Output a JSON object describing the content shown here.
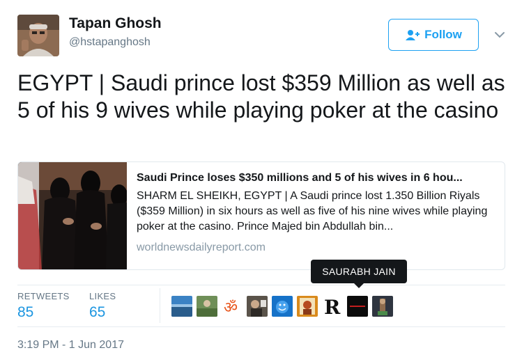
{
  "user": {
    "name": "Tapan Ghosh",
    "handle": "@hstapanghosh"
  },
  "follow_button": {
    "label": "Follow"
  },
  "tweet": {
    "text": "EGYPT | Saudi prince lost $359 Million as well as 5 of his 9 wives while playing poker at the casino"
  },
  "card": {
    "title": "Saudi Prince loses $350 millions and 5 of his wives in 6 hou...",
    "description": "SHARM EL SHEIKH, EGYPT | A Saudi prince lost 1.350 Billion Riyals ($359 Million) in six hours as well as five of his nine wives while playing poker at the casino. Prince Majed bin Abdullah bin...",
    "domain": "worldnewsdailyreport.com"
  },
  "stats": {
    "retweets_label": "RETWEETS",
    "retweets_value": "85",
    "likes_label": "LIKES",
    "likes_value": "65"
  },
  "tooltip": {
    "text": "SAURABH JAIN"
  },
  "timestamp": "3:19 PM - 1 Jun 2017",
  "colors": {
    "accent": "#1da1f2",
    "stat_value": "#1b95e0",
    "secondary_text": "#657786"
  },
  "icons": {
    "follow": "add-user-icon",
    "caret": "chevron-down-icon"
  }
}
